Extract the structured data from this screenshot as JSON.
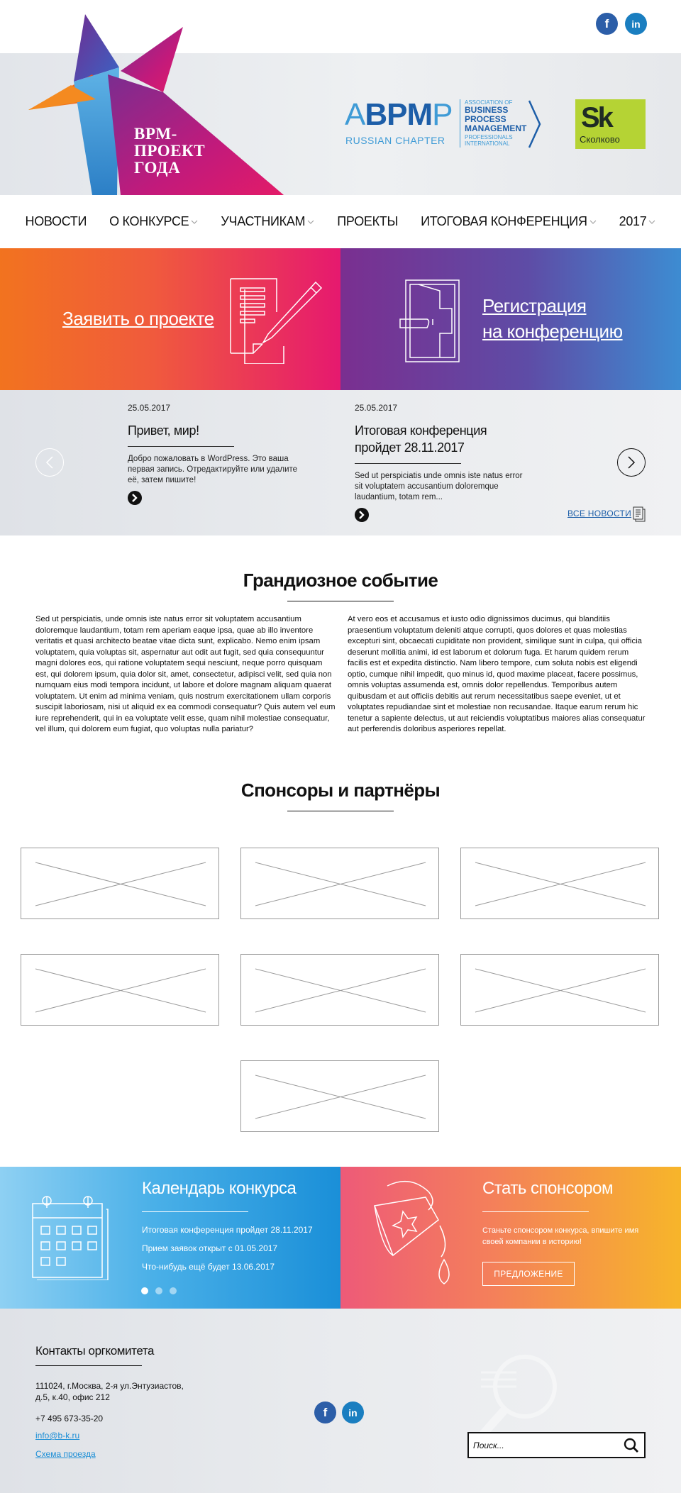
{
  "header": {
    "logo_line1": "BPM-",
    "logo_line2": "ПРОЕКТ",
    "logo_line3": "ГОДА",
    "abpmp": {
      "big_a": "A",
      "big_bpm": "BPM",
      "big_p": "P",
      "assoc": "Association of",
      "bpm_line1": "Business",
      "bpm_line2": "Process",
      "bpm_line3": "Management",
      "prof_line1": "Professionals",
      "prof_line2": "International",
      "chapter": "RUSSIAN CHAPTER"
    },
    "skolkovo": {
      "mark": "Sk",
      "name": "Сколково"
    },
    "social": {
      "fb": "f",
      "in": "in"
    }
  },
  "nav": {
    "items": [
      {
        "label": "НОВОСТИ",
        "has_dropdown": false
      },
      {
        "label": "О КОНКУРСЕ",
        "has_dropdown": true
      },
      {
        "label": "УЧАСТНИКАМ",
        "has_dropdown": true
      },
      {
        "label": "ПРОЕКТЫ",
        "has_dropdown": false
      },
      {
        "label": "ИТОГОВАЯ КОНФЕРЕНЦИЯ",
        "has_dropdown": true
      },
      {
        "label": "2017",
        "has_dropdown": true
      }
    ]
  },
  "actions": {
    "apply": "Заявить о проекте",
    "register_line1": "Регистрация",
    "register_line2": "на конференцию"
  },
  "news": {
    "items": [
      {
        "date": "25.05.2017",
        "title": "Привет, мир!",
        "text": "Добро пожаловать в WordPress. Это ваша первая запись. Отредактируйте или удалите её, затем пишите!"
      },
      {
        "date": "25.05.2017",
        "title_line1": "Итоговая конференция",
        "title_line2": "пройдет 28.11.2017",
        "text": "Sed ut perspiciatis unde omnis iste natus error sit voluptatem accusantium doloremque laudantium, totam rem..."
      }
    ],
    "all_news": "ВСЕ НОВОСТИ"
  },
  "about": {
    "title": "Грандиозное событие",
    "col1": "Sed ut perspiciatis, unde omnis iste natus error sit voluptatem accusantium doloremque laudantium, totam rem aperiam eaque ipsa, quae ab illo inventore veritatis et quasi architecto beatae vitae dicta sunt, explicabo. Nemo enim ipsam voluptatem, quia voluptas sit, aspernatur aut odit aut fugit, sed quia consequuntur magni dolores eos, qui ratione voluptatem sequi nesciunt, neque porro quisquam est, qui dolorem ipsum, quia dolor sit, amet, consectetur, adipisci velit, sed quia non numquam eius modi tempora incidunt, ut labore et dolore magnam aliquam quaerat voluptatem. Ut enim ad minima veniam, quis nostrum exercitationem ullam corporis suscipit laboriosam, nisi ut aliquid ex ea commodi consequatur? Quis autem vel eum iure reprehenderit, qui in ea voluptate velit esse, quam nihil molestiae consequatur, vel illum, qui dolorem eum fugiat, quo voluptas nulla pariatur?",
    "col2": "At vero eos et accusamus et iusto odio dignissimos ducimus, qui blanditiis praesentium voluptatum deleniti atque corrupti, quos dolores et quas molestias excepturi sint, obcaecati cupiditate non provident, similique sunt in culpa, qui officia deserunt mollitia animi, id est laborum et dolorum fuga. Et harum quidem rerum facilis est et expedita distinctio. Nam libero tempore, cum soluta nobis est eligendi optio, cumque nihil impedit, quo minus id, quod maxime placeat, facere possimus, omnis voluptas assumenda est, omnis dolor repellendus. Temporibus autem quibusdam et aut officiis debitis aut rerum necessitatibus saepe eveniet, ut et voluptates repudiandae sint et molestiae non recusandae. Itaque earum rerum hic tenetur a sapiente delectus, ut aut reiciendis voluptatibus maiores alias consequatur aut perferendis doloribus asperiores repellat."
  },
  "sponsors": {
    "title": "Спонсоры и партнёры",
    "count": 7
  },
  "calendar": {
    "title": "Календарь конкурса",
    "events": [
      "Итоговая конференция пройдет 28.11.2017",
      "Прием заявок открыт с 01.05.2017",
      "Что-нибудь ещё будет 13.06.2017"
    ],
    "active_dot": 0
  },
  "sponsor_cta": {
    "title": "Стать спонсором",
    "text_line1": "Станьте спонсором конкурса, впишите имя",
    "text_line2": "своей компании в историю!",
    "button": "ПРЕДЛОЖЕНИЕ"
  },
  "footer": {
    "title": "Контакты оргкомитета",
    "address_line1": "111024, г.Москва, 2-я ул.Энтузиастов,",
    "address_line2": "д.5, к.40, офис 212",
    "phone": "+7 495 673-35-20",
    "email": "info@b-k.ru",
    "map": "Схема проезда",
    "search_placeholder": "Поиск..."
  },
  "colors": {
    "brand_blue": "#1d5ea8",
    "link_blue": "#1d8fd6",
    "skolkovo_green": "#b5d334"
  }
}
